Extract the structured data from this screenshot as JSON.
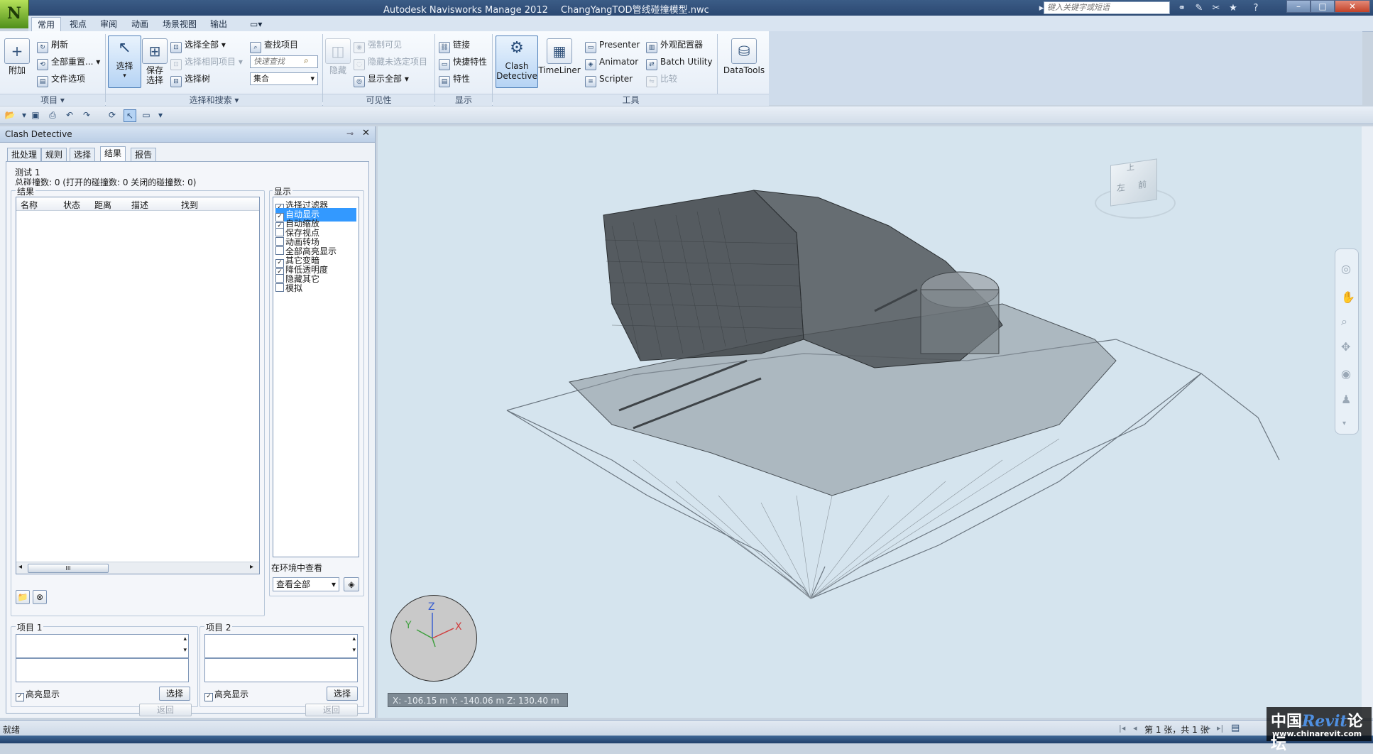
{
  "window": {
    "app_title": "Autodesk Navisworks Manage 2012",
    "file_name": "ChangYangTOD管线碰撞模型.nwc",
    "search_placeholder": "键入关键字或短语"
  },
  "ribbon_tabs": [
    "常用",
    "视点",
    "审阅",
    "动画",
    "场景视图",
    "输出"
  ],
  "ribbon": {
    "project": {
      "append": "附加",
      "refresh": "刷新",
      "reset_all": "全部重置...",
      "file_options": "文件选项",
      "group": "项目"
    },
    "select_search": {
      "select": "选择",
      "save_selection_line1": "保存",
      "save_selection_line2": "选择",
      "select_all": "选择全部",
      "select_same": "选择相同项目",
      "selection_tree": "选择树",
      "find_items": "查找项目",
      "quick_find_placeholder": "快速查找",
      "sets": "集合",
      "group": "选择和搜索"
    },
    "visibility": {
      "hide": "隐藏",
      "require": "强制可见",
      "hide_unselected": "隐藏未选定项目",
      "unhide_all": "显示全部",
      "group": "可见性"
    },
    "display": {
      "links": "链接",
      "quick_props": "快捷特性",
      "properties": "特性",
      "group": "显示"
    },
    "tools": {
      "clash_line1": "Clash",
      "clash_line2": "Detective",
      "timeliner": "TimeLiner",
      "presenter": "Presenter",
      "animator": "Animator",
      "scripter": "Scripter",
      "appearance": "外观配置器",
      "batch": "Batch Utility",
      "compare": "比较",
      "datatools": "DataTools",
      "group": "工具"
    }
  },
  "panel": {
    "title": "Clash Detective",
    "tabs": [
      "批处理",
      "规则",
      "选择",
      "结果",
      "报告"
    ],
    "test_name": "测试 1",
    "summary": "总碰撞数: 0 (打开的碰撞数: 0 关闭的碰撞数: 0)",
    "results_label": "结果",
    "columns": [
      "名称",
      "状态",
      "距离",
      "描述",
      "找到"
    ],
    "scroll_grip": "III",
    "display_label": "显示",
    "display_options": [
      {
        "label": "选择过滤器",
        "checked": true
      },
      {
        "label": "自动显示",
        "checked": true
      },
      {
        "label": "自动缩放",
        "checked": true
      },
      {
        "label": "保存视点",
        "checked": false
      },
      {
        "label": "动画转场",
        "checked": false
      },
      {
        "label": "全部高亮显示",
        "checked": false
      },
      {
        "label": "其它变暗",
        "checked": true
      },
      {
        "label": "降低透明度",
        "checked": true
      },
      {
        "label": "隐藏其它",
        "checked": false
      },
      {
        "label": "模拟",
        "checked": false
      }
    ],
    "env_view_label": "在环境中查看",
    "env_view_value": "查看全部",
    "item1": {
      "label": "项目 1",
      "highlight": "高亮显示",
      "select": "选择",
      "back": "返回"
    },
    "item2": {
      "label": "项目 2",
      "highlight": "高亮显示",
      "select": "选择",
      "back": "返回"
    }
  },
  "viewport": {
    "coordinates": "X: -106.15 m  Y: -140.06 m  Z: 130.40 m",
    "axis_x": "X",
    "axis_y": "Y",
    "axis_z": "Z",
    "viewcube_top": "上",
    "viewcube_left": "左",
    "viewcube_front": "前"
  },
  "status": {
    "left": "就绪",
    "page": "第 1 张，共 1 张"
  },
  "watermark": {
    "brand_cn": "中国",
    "brand_en": "Revit",
    "brand_cn2": "论坛",
    "url": "www.chinarevit.com"
  },
  "colors": {
    "title_bar": "#2a4670",
    "ribbon_active": "#b5d3f4",
    "viewport_bg": "#d5e4ee",
    "highlight_row": "#3399ff"
  }
}
